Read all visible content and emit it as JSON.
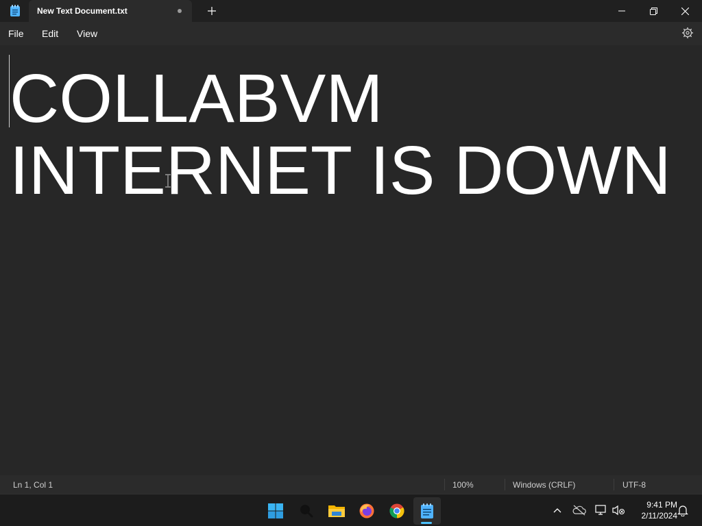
{
  "window": {
    "tab_title": "New Text Document.txt",
    "unsaved_indicator": "dot",
    "controls": [
      "minimize",
      "restore",
      "close"
    ]
  },
  "menu": {
    "file": "File",
    "edit": "Edit",
    "view": "View"
  },
  "editor": {
    "lines": [
      "COLLABVM",
      "INTERNET IS DOWN"
    ]
  },
  "status": {
    "position": "Ln 1, Col 1",
    "zoom": "100%",
    "line_ending": "Windows (CRLF)",
    "encoding": "UTF-8"
  },
  "taskbar": {
    "apps": [
      "start-icon",
      "search-icon",
      "file-explorer-icon",
      "firefox-icon",
      "chrome-icon",
      "notepad-icon"
    ],
    "active_app": "notepad-icon",
    "tray": [
      "chevron-up-icon",
      "onedrive-offline-icon",
      "network-icon",
      "volume-muted-icon",
      "bell-icon"
    ],
    "time": "9:41 PM",
    "date": "2/11/2024"
  },
  "colors": {
    "editor_bg": "#272727",
    "titlebar_bg": "#202020",
    "taskbar_bg": "#1c1c1c",
    "accent": "#4cc2ff",
    "notepad_icon": "#4fb3ff"
  }
}
